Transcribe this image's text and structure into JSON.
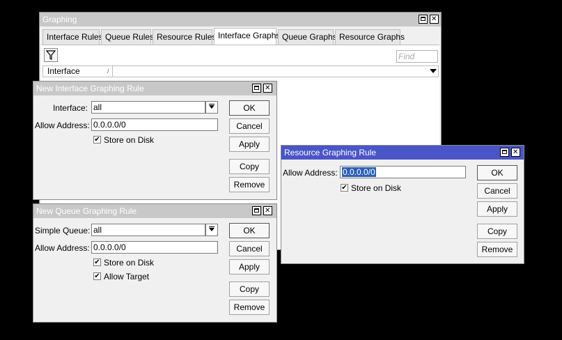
{
  "graphing": {
    "title": "Graphing",
    "tabs": [
      "Interface Rules",
      "Queue Rules",
      "Resource Rules",
      "Interface Graphs",
      "Queue Graphs",
      "Resource Graphs"
    ],
    "active_tab": "Interface Graphs",
    "find_placeholder": "Find",
    "column_interface": "Interface",
    "sort_indicator": "/"
  },
  "interface_rule": {
    "title": "New Interface Graphing Rule",
    "interface_label": "Interface:",
    "interface_value": "all",
    "allow_label": "Allow Address:",
    "allow_value": "0.0.0.0/0",
    "store_label": "Store on Disk",
    "store_checked": true,
    "buttons": {
      "ok": "OK",
      "cancel": "Cancel",
      "apply": "Apply",
      "copy": "Copy",
      "remove": "Remove"
    }
  },
  "queue_rule": {
    "title": "New Queue Graphing Rule",
    "queue_label": "Simple Queue:",
    "queue_value": "all",
    "allow_label": "Allow Address:",
    "allow_value": "0.0.0.0/0",
    "store_label": "Store on Disk",
    "store_checked": true,
    "target_label": "Allow Target",
    "target_checked": true,
    "buttons": {
      "ok": "OK",
      "cancel": "Cancel",
      "apply": "Apply",
      "copy": "Copy",
      "remove": "Remove"
    }
  },
  "resource_rule": {
    "title": "Resource Graphing Rule",
    "allow_label": "Allow Address:",
    "allow_value": "0.0.0.0/0",
    "store_label": "Store on Disk",
    "store_checked": true,
    "buttons": {
      "ok": "OK",
      "cancel": "Cancel",
      "apply": "Apply",
      "copy": "Copy",
      "remove": "Remove"
    }
  },
  "icons": {
    "check": "✔"
  },
  "colors": {
    "active_title": "#4a55c8",
    "inactive_title": "#c8c8c8",
    "selection": "#2b5fb8"
  }
}
